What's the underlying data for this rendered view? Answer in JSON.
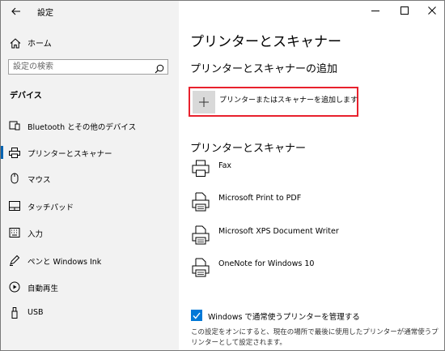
{
  "window": {
    "title": "設定",
    "controls": [
      "minimize",
      "maximize",
      "close"
    ]
  },
  "sidebar": {
    "home_label": "ホーム",
    "search_placeholder": "設定の検索",
    "section_label": "デバイス",
    "items": [
      {
        "label": "Bluetooth とその他のデバイス",
        "icon": "bluetooth-devices-icon"
      },
      {
        "label": "プリンターとスキャナー",
        "icon": "printer-icon",
        "selected": true
      },
      {
        "label": "マウス",
        "icon": "mouse-icon"
      },
      {
        "label": "タッチパッド",
        "icon": "touchpad-icon"
      },
      {
        "label": "入力",
        "icon": "keyboard-icon"
      },
      {
        "label": "ペンと Windows Ink",
        "icon": "pen-icon"
      },
      {
        "label": "自動再生",
        "icon": "autoplay-icon"
      },
      {
        "label": "USB",
        "icon": "usb-icon"
      }
    ]
  },
  "main": {
    "title": "プリンターとスキャナー",
    "add_section_heading": "プリンターとスキャナーの追加",
    "add_button_label": "プリンターまたはスキャナーを追加します",
    "list_heading": "プリンターとスキャナー",
    "printers": [
      {
        "name": "Fax",
        "icon": "fax-printer-icon"
      },
      {
        "name": "Microsoft Print to PDF",
        "icon": "document-printer-icon"
      },
      {
        "name": "Microsoft XPS Document Writer",
        "icon": "document-printer-icon"
      },
      {
        "name": "OneNote for Windows 10",
        "icon": "document-printer-icon"
      }
    ],
    "manage_checkbox": {
      "label": "Windows で通常使うプリンターを管理する",
      "checked": true
    },
    "description": "この設定をオンにすると、現在の場所で最後に使用したプリンターが通常使うプリンターとして設定されます。"
  },
  "colors": {
    "sidebar_bg": "#f2f2f2",
    "accent": "#0078d7",
    "highlight_border": "#e8212d"
  }
}
